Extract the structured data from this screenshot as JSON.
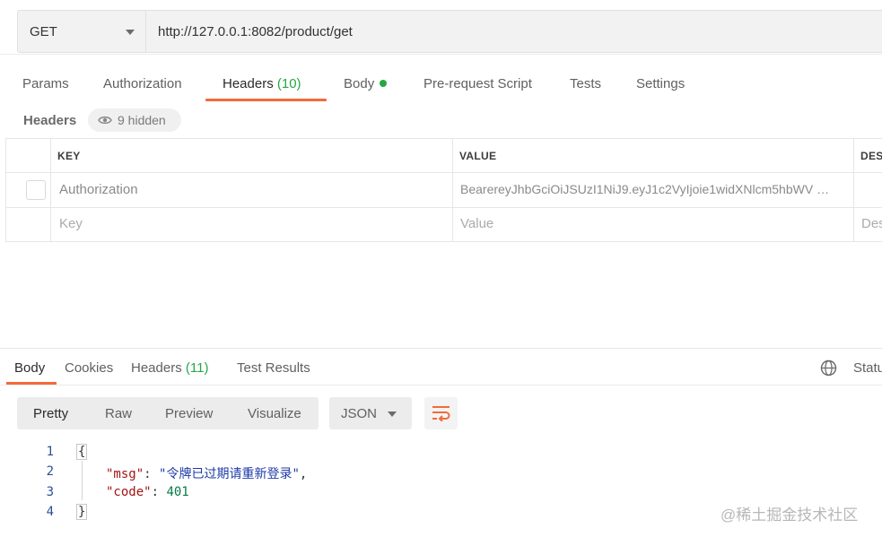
{
  "request": {
    "method": "GET",
    "url": "http://127.0.0.1:8082/product/get"
  },
  "request_tabs": {
    "params": "Params",
    "authorization": "Authorization",
    "headers": "Headers",
    "headers_count": "(10)",
    "body": "Body",
    "pre_request": "Pre-request Script",
    "tests": "Tests",
    "settings": "Settings"
  },
  "headers_section": {
    "title": "Headers",
    "hidden": "9 hidden",
    "columns": {
      "key": "KEY",
      "value": "VALUE",
      "description": "DES"
    },
    "rows": [
      {
        "key": "Authorization",
        "value": "BearereyJhbGciOiJSUzI1NiJ9.eyJ1c2VyIjoie1widXNlcm5hbWV …"
      }
    ],
    "placeholder": {
      "key": "Key",
      "value": "Value",
      "description": "Des"
    }
  },
  "response_tabs": {
    "body": "Body",
    "cookies": "Cookies",
    "headers": "Headers",
    "headers_count": "(11)",
    "test_results": "Test Results",
    "status": "Statu"
  },
  "view_modes": {
    "pretty": "Pretty",
    "raw": "Raw",
    "preview": "Preview",
    "visualize": "Visualize",
    "format": "JSON"
  },
  "code": {
    "line_numbers": [
      "1",
      "2",
      "3",
      "4"
    ],
    "open_brace": "{",
    "close_brace": "}",
    "lines": [
      {
        "key": "\"msg\"",
        "value": "\"令牌已过期请重新登录\"",
        "suffix": ","
      },
      {
        "key": "\"code\"",
        "value": "401",
        "suffix": ""
      }
    ]
  },
  "watermark": "@稀土掘金技术社区",
  "colors": {
    "accent": "#f26b3a",
    "count_green": "#26a744"
  },
  "icons": {
    "method_dropdown": "chevron-down-icon",
    "hidden": "eye-icon",
    "status": "globe-icon",
    "wrap": "wrap-lines-icon"
  }
}
